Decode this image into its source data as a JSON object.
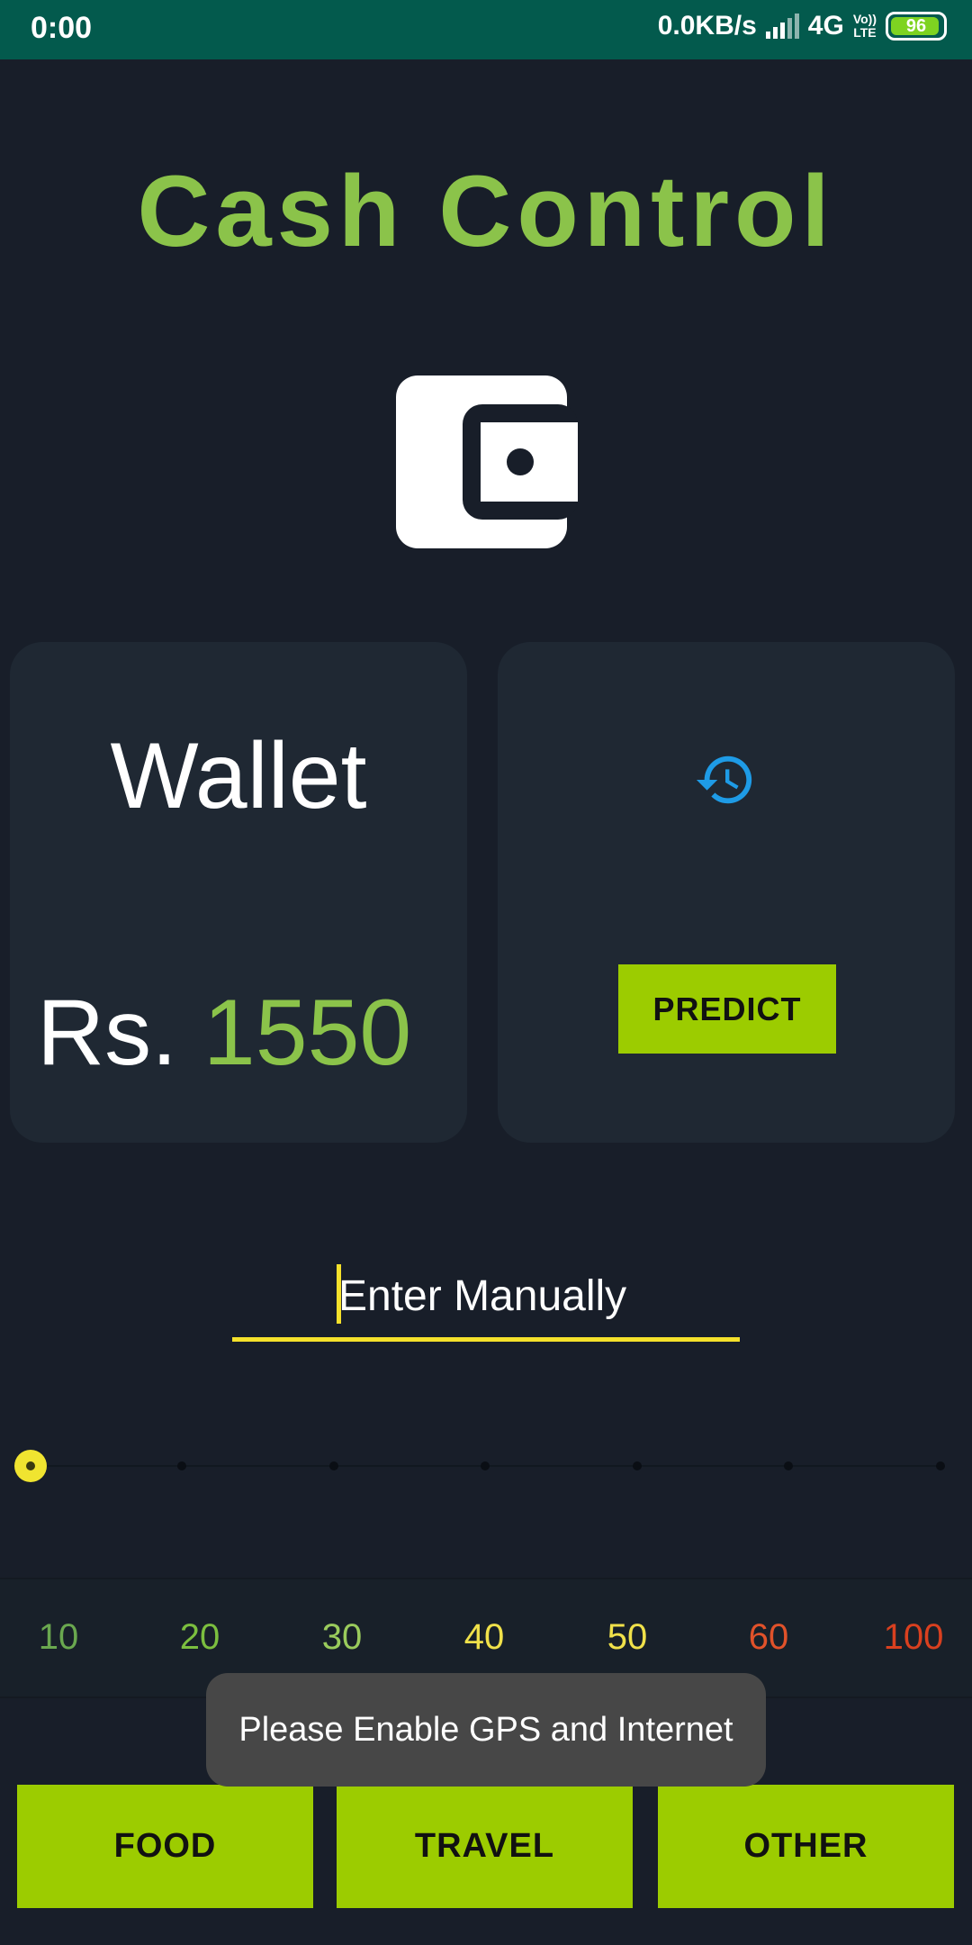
{
  "status_bar": {
    "time": "0:00",
    "network_speed": "0.0KB/s",
    "network_type": "4G",
    "volte_top": "Vo))",
    "volte_bottom": "LTE",
    "battery": "96"
  },
  "app": {
    "title": "Cash Control",
    "logo_icon": "wallet-icon"
  },
  "wallet_card": {
    "title": "Wallet",
    "currency_prefix": "Rs.",
    "amount": "1550"
  },
  "predict_card": {
    "icon": "history-icon",
    "button_label": "PREDICT"
  },
  "manual_entry": {
    "placeholder": "Enter Manually"
  },
  "slider": {
    "selected_value": "10",
    "stop_count": 7
  },
  "scale_labels": [
    {
      "text": "10",
      "color": "#6aa84f"
    },
    {
      "text": "20",
      "color": "#7cbf3f"
    },
    {
      "text": "30",
      "color": "#9acb5c"
    },
    {
      "text": "40",
      "color": "#f0e14a"
    },
    {
      "text": "50",
      "color": "#f0e14a"
    },
    {
      "text": "60",
      "color": "#e1522a"
    },
    {
      "text": "100",
      "color": "#d9401f"
    }
  ],
  "toast": {
    "message": "Please Enable GPS and Internet"
  },
  "categories": {
    "food": "FOOD",
    "travel": "TRAVEL",
    "other": "OTHER"
  },
  "colors": {
    "background": "#181e29",
    "status_bar": "#035a4d",
    "accent_green": "#8bc34a",
    "button_green": "#9ccc00",
    "accent_yellow": "#f5e12b",
    "history_blue": "#1e9be6"
  }
}
